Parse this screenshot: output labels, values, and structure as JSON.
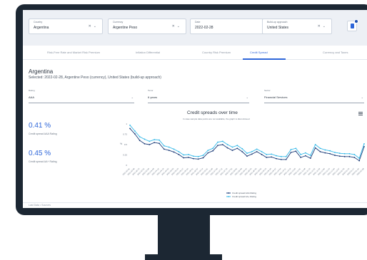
{
  "filters": [
    {
      "label": "Country",
      "value": "Argentina"
    },
    {
      "label": "Currency",
      "value": "Argentine Peso"
    },
    {
      "label": "Date",
      "value": "2022-02-28"
    },
    {
      "label": "Build-up approach",
      "value": "United States"
    }
  ],
  "tabs": [
    {
      "label": "Risk-Free Rate and Market Risk Premium",
      "active": false
    },
    {
      "label": "Inflation Differential",
      "active": false
    },
    {
      "label": "Country Risk Premium",
      "active": false
    },
    {
      "label": "Credit Spread",
      "active": true
    },
    {
      "label": "Currency and Taxes",
      "active": false
    }
  ],
  "page": {
    "title": "Argentina",
    "subtitle": "Selected: 2022-02-28, Argentine Peso (currency), United States (build-up approach)"
  },
  "selects": {
    "rating": {
      "label": "Rating",
      "value": "AAA"
    },
    "tenor": {
      "label": "Tenor",
      "value": "6 years"
    },
    "sector": {
      "label": "Sector",
      "value": "Financial Services"
    }
  },
  "kpis": [
    {
      "value": "0.41 %",
      "label": "Credit spread AAA Rating"
    },
    {
      "value": "0.45 %",
      "label": "Credit spread AA+ Rating"
    }
  ],
  "footer": {
    "text": "Last Data • Sources"
  },
  "colors": {
    "accent": "#2e66d9",
    "series_aaa": "#1d3c78",
    "series_aa_plus": "#33b8e8"
  },
  "chart_data": {
    "type": "line",
    "title": "Credit spreads over time",
    "subtitle": "In case sample data points are not available, the graph is discontinued",
    "ylabel": "%",
    "ylim": [
      0,
      1
    ],
    "yticks": [
      0,
      0.25,
      0.5,
      0.75,
      1
    ],
    "x": [
      "2021-03-01",
      "2021-03-08",
      "2021-03-15",
      "2021-03-22",
      "2021-03-29",
      "2021-04-05",
      "2021-04-12",
      "2021-04-19",
      "2021-04-26",
      "2021-05-03",
      "2021-05-10",
      "2021-05-17",
      "2021-05-24",
      "2021-05-31",
      "2021-06-07",
      "2021-06-14",
      "2021-06-21",
      "2021-06-28",
      "2021-07-05",
      "2021-07-12",
      "2021-07-19",
      "2021-07-26",
      "2021-08-02",
      "2021-08-09",
      "2021-08-16",
      "2021-08-23",
      "2021-08-30",
      "2021-09-06",
      "2021-09-13",
      "2021-09-20",
      "2021-09-27",
      "2021-10-04",
      "2021-10-11",
      "2021-10-18",
      "2021-10-25",
      "2021-11-01",
      "2021-11-08",
      "2021-11-15",
      "2021-11-22",
      "2021-11-29",
      "2021-12-06",
      "2021-12-13",
      "2021-12-20",
      "2021-12-27",
      "2022-01-03",
      "2022-01-10",
      "2022-01-17",
      "2022-01-24",
      "2022-02-28"
    ],
    "series": [
      {
        "name": "Credit spread AAA Rating",
        "values": [
          0.89,
          0.76,
          0.6,
          0.52,
          0.5,
          0.55,
          0.53,
          0.39,
          0.36,
          0.32,
          0.26,
          0.18,
          0.19,
          0.16,
          0.15,
          0.18,
          0.3,
          0.35,
          0.48,
          0.5,
          0.42,
          0.36,
          0.41,
          0.33,
          0.22,
          0.27,
          0.33,
          0.26,
          0.19,
          0.2,
          0.16,
          0.14,
          0.14,
          0.31,
          0.34,
          0.19,
          0.23,
          0.17,
          0.42,
          0.33,
          0.3,
          0.28,
          0.24,
          0.22,
          0.21,
          0.21,
          0.19,
          0.11,
          0.45
        ]
      },
      {
        "name": "Credit spread AA+ Rating",
        "values": [
          0.97,
          0.83,
          0.69,
          0.63,
          0.58,
          0.62,
          0.61,
          0.47,
          0.44,
          0.39,
          0.33,
          0.25,
          0.26,
          0.22,
          0.21,
          0.24,
          0.36,
          0.41,
          0.56,
          0.58,
          0.5,
          0.44,
          0.48,
          0.4,
          0.29,
          0.33,
          0.39,
          0.33,
          0.26,
          0.27,
          0.23,
          0.21,
          0.21,
          0.38,
          0.41,
          0.26,
          0.3,
          0.24,
          0.5,
          0.41,
          0.37,
          0.35,
          0.31,
          0.29,
          0.28,
          0.28,
          0.26,
          0.17,
          0.52
        ]
      }
    ],
    "legend": "bottom-center",
    "grid": false
  }
}
